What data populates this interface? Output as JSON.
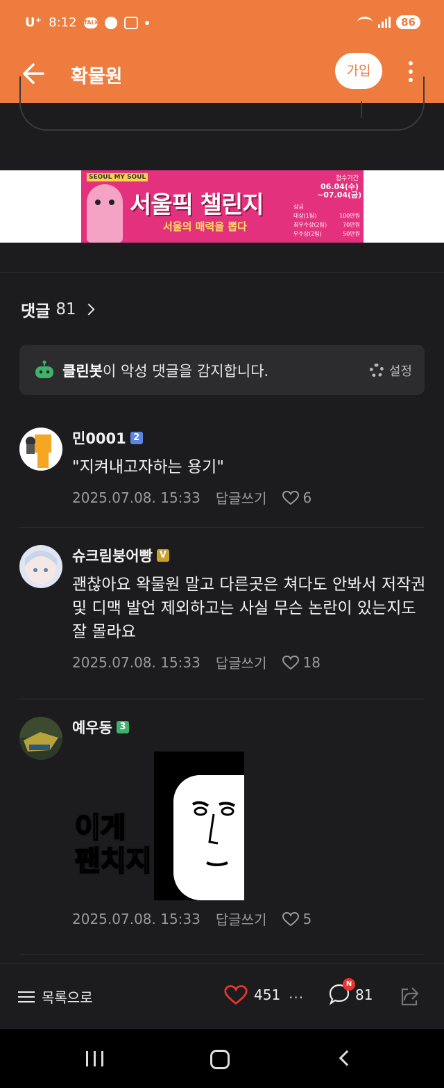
{
  "status_bar": {
    "carrier": "U⁺",
    "time": "8:12",
    "talk_icon_label": "TALK",
    "battery": "86"
  },
  "app_bar": {
    "title": "확물원",
    "join_label": "가입"
  },
  "banner": {
    "brand": "SEOUL MY SOUL",
    "title": "서울픽 챌린지",
    "subtitle": "서울의 매력을 뽑다",
    "period_label": "접수기간",
    "period_start": "06.04(수)",
    "period_end": "~07.04(금)",
    "prize_label": "상금",
    "prizes": [
      {
        "rank": "대상(1팀)",
        "amount": "100만원"
      },
      {
        "rank": "최우수상(2팀)",
        "amount": "70만원"
      },
      {
        "rank": "우수상(2팀)",
        "amount": "50만원"
      }
    ]
  },
  "comments_section": {
    "label": "댓글",
    "count": "81",
    "cleanbot_name": "클린봇",
    "cleanbot_message": "이 악성 댓글을 감지합니다.",
    "settings_label": "설정"
  },
  "comments": [
    {
      "author": "민0001",
      "badge": "2",
      "text": "\"지켜내고자하는 용기\"",
      "date": "2025.07.08. 15:33",
      "reply_label": "답글쓰기",
      "likes": "6"
    },
    {
      "author": "슈크림붕어빵",
      "badge": "V",
      "text": "괜찮아요 왁물원 말고 다른곳은 쳐다도 안봐서 저작권 및 디맥 발언 제외하고는 사실 무슨 논란이 있는지도 잘 몰라요",
      "date": "2025.07.08. 15:33",
      "reply_label": "답글쓰기",
      "likes": "18"
    },
    {
      "author": "예우동",
      "badge": "3",
      "image_text": "이게\n팬치지",
      "date": "2025.07.08. 15:33",
      "reply_label": "답글쓰기",
      "likes": "5"
    }
  ],
  "bottom_bar": {
    "list_label": "목록으로",
    "likes": "451",
    "more_label": "···",
    "comments": "81",
    "new_badge": "N"
  },
  "colors": {
    "accent": "#ee7c3e",
    "background": "#1c1c1e",
    "heart": "#e8362f"
  }
}
